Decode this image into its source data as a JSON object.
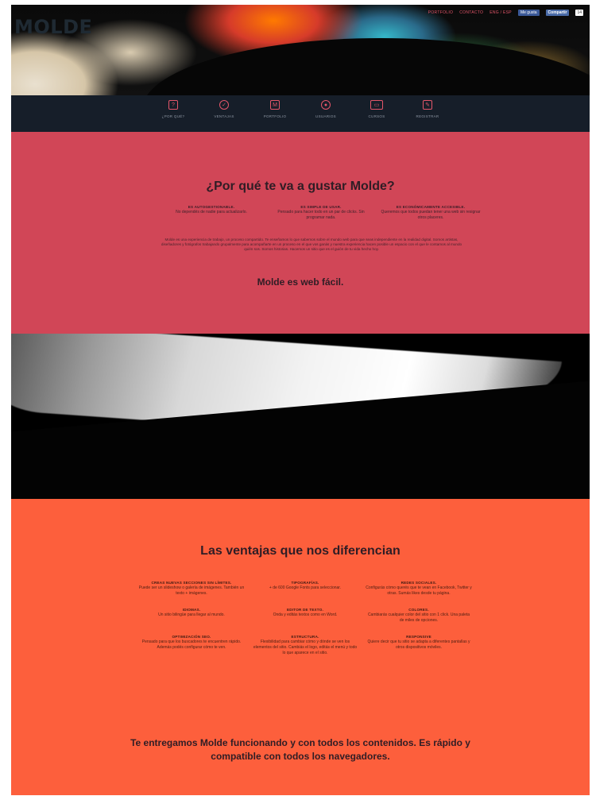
{
  "brand": {
    "logo": "MOLDE"
  },
  "topnav": {
    "links": [
      "PORTFOLIO",
      "CONTACTO",
      "ENG / ESP"
    ],
    "like_label": "Me gusta",
    "share_label": "Compartir",
    "share_count": "14"
  },
  "iconnav": [
    {
      "label": "¿POR QUÉ?",
      "icon": "question-icon"
    },
    {
      "label": "VENTAJAS",
      "icon": "check-circle-icon"
    },
    {
      "label": "PORTFOLIO",
      "icon": "portfolio-icon"
    },
    {
      "label": "USUARIOS",
      "icon": "user-icon"
    },
    {
      "label": "CURSOS",
      "icon": "screen-icon"
    },
    {
      "label": "REGISTRAR",
      "icon": "register-icon"
    }
  ],
  "why": {
    "title": "¿Por qué te va a gustar Molde?",
    "features": [
      {
        "title": "ES AUTOGESTIONABLE.",
        "desc": "No dependés de nadie para actualizarlo."
      },
      {
        "title": "ES SIMPLE DE USAR.",
        "desc": "Pensado para hacer todo en un par de clicks. Sin programar nada."
      },
      {
        "title": "ES ECONÓMICAMENTE ACCESIBLE.",
        "desc": "Queremos que todos puedan tener una web sin resignar otros placeres."
      }
    ],
    "paragraph": "Molde es una experiencia de trabajo, un proceso compartido. Te enseñamos lo que sabemos sobre el mundo web para que seas independiente en la realidad digital. Somos artistas, diseñadores y fotógrafos trabajando grupalmente para acompañarte en un proceso en el que vos ganás y nuestra experiencia hacen posible un espacio con el que le contamos al mundo quién sos. Somos historias. Hacemos un sitio que es el guión de tu vida hecho hoy.",
    "tagline": "Molde es web fácil."
  },
  "advantages": {
    "title": "Las ventajas que nos diferencian",
    "items": [
      {
        "title": "CREAS NUEVAS SECCIONES SIN LÍMITES.",
        "desc": "Puede ser un slideshow o galería de imágenes. También un texto + imágenes."
      },
      {
        "title": "TIPOGRAFÍAS.",
        "desc": "+ de 600 Google Fonts para seleccionar."
      },
      {
        "title": "REDES SOCIALES.",
        "desc": "Configurás cómo querés que te vean en Facebook, Twitter y otras. Sumás likes desde tu página."
      },
      {
        "title": "IDIOMAS.",
        "desc": "Un sitio bilingüe para llegar al mundo."
      },
      {
        "title": "EDITOR DE TEXTO.",
        "desc": "Onda y editás textos como en Word."
      },
      {
        "title": "COLORES.",
        "desc": "Cambiarás cualquier color del sitio con 1 click. Una paleta de miles de opciones."
      },
      {
        "title": "OPTIMIZACIÓN SEO.",
        "desc": "Pensado para que los buscadores te encuentren rápido. Además podés configurar cómo te ven."
      },
      {
        "title": "ESTRUCTURA.",
        "desc": "Flexibilidad para cambiar cómo y dónde se ven los elementos del sitio. Cambiás el logo, editás el menú y todo lo que aparece en el sitio."
      },
      {
        "title": "RESPONSIVE",
        "desc": "Quiere decir que tu sitio se adapta a diferentes pantallas y otros dispositivos móviles."
      }
    ],
    "closing": "Te entregamos Molde funcionando y con todos los contenidos. Es rápido y compatible con todos los navegadores."
  },
  "colors": {
    "pink": "#d14657",
    "orange": "#fd5f3c",
    "navbar": "#161e29",
    "accent": "#e4566a"
  }
}
